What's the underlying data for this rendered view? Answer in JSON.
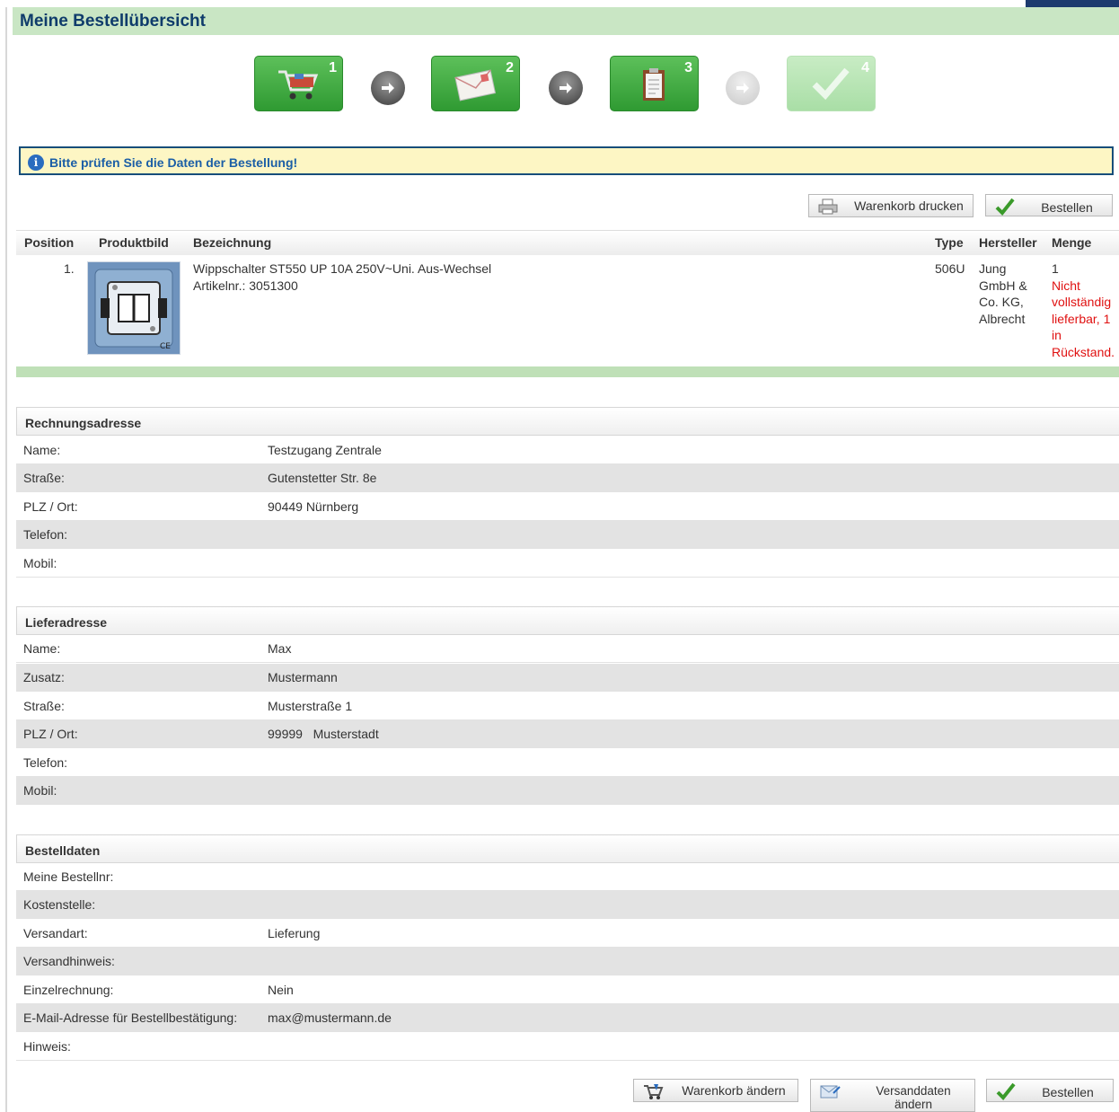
{
  "page_title": "Meine Bestellübersicht",
  "steps": [
    {
      "number": "1",
      "icon": "shopping-cart-icon",
      "state": "done"
    },
    {
      "number": "2",
      "icon": "envelope-icon",
      "state": "done"
    },
    {
      "number": "3",
      "icon": "clipboard-icon",
      "state": "current"
    },
    {
      "number": "4",
      "icon": "checkmark-icon",
      "state": "pending"
    }
  ],
  "info_message": "Bitte prüfen Sie die Daten der Bestellung!",
  "top_buttons": {
    "print": "Warenkorb drucken",
    "order": "Bestellen"
  },
  "table": {
    "headers": {
      "position": "Position",
      "image": "Produktbild",
      "name": "Bezeichnung",
      "type": "Type",
      "manufacturer": "Hersteller",
      "quantity": "Menge"
    },
    "rows": [
      {
        "position": "1.",
        "name": "Wippschalter ST550 UP 10A 250V~Uni. Aus-Wechsel",
        "article": "Artikelnr.: 3051300",
        "type": "506U",
        "manufacturer_lines": [
          "Jung",
          "GmbH &",
          "Co. KG,",
          "Albrecht"
        ],
        "quantity": "1",
        "availability_lines": [
          "Nicht",
          "vollständig",
          "lieferbar, 1",
          "in",
          "Rückstand."
        ]
      }
    ]
  },
  "billing": {
    "title": "Rechnungsadresse",
    "rows": [
      {
        "label": "Name:",
        "value": "Testzugang Zentrale"
      },
      {
        "label": "Straße:",
        "value": "Gutenstetter Str. 8e"
      },
      {
        "label": "PLZ / Ort:",
        "value": "90449 Nürnberg"
      },
      {
        "label": "Telefon:",
        "value": ""
      },
      {
        "label": "Mobil:",
        "value": ""
      }
    ]
  },
  "delivery": {
    "title": "Lieferadresse",
    "rows": [
      {
        "label": "Name:",
        "value": "Max"
      },
      {
        "label": "Zusatz:",
        "value": "Mustermann"
      },
      {
        "label": "Straße:",
        "value": "Musterstraße 1"
      },
      {
        "label": "PLZ / Ort:",
        "value": "99999   Musterstadt"
      },
      {
        "label": "Telefon:",
        "value": ""
      },
      {
        "label": "Mobil:",
        "value": ""
      }
    ]
  },
  "order_data": {
    "title": "Bestelldaten",
    "rows": [
      {
        "label": "Meine Bestellnr:",
        "value": ""
      },
      {
        "label": "Kostenstelle:",
        "value": ""
      },
      {
        "label": "Versandart:",
        "value": "Lieferung"
      },
      {
        "label": "Versandhinweis:",
        "value": ""
      },
      {
        "label": "Einzelrechnung:",
        "value": "Nein"
      },
      {
        "label": "E-Mail-Adresse für Bestellbestätigung:",
        "value": "max@mustermann.de"
      },
      {
        "label": "Hinweis:",
        "value": ""
      }
    ]
  },
  "bottom_buttons": {
    "change_cart": "Warenkorb ändern",
    "change_shipping": "Versanddaten ändern",
    "order": "Bestellen"
  },
  "colors": {
    "title_bg": "#c9e6c4",
    "title_text": "#0f3c6b",
    "info_bg": "#fdf6c4",
    "info_border": "#174e7a",
    "alert_red": "#e01010",
    "step_green": "#3aa83a"
  }
}
